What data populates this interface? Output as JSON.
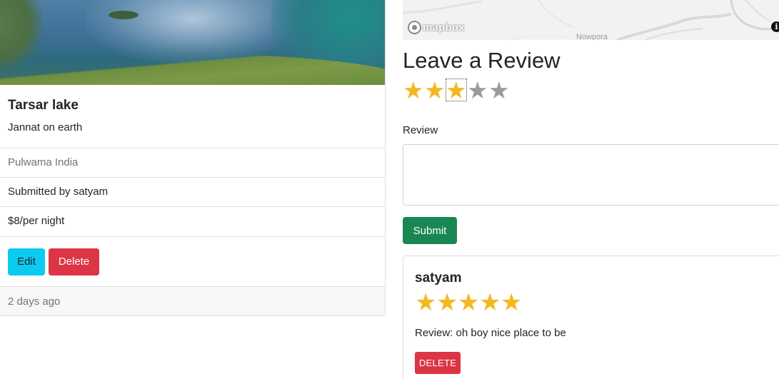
{
  "campground": {
    "title": "Tarsar lake",
    "description": "Jannat on earth",
    "location": "Pulwama India",
    "submitted_by": "Submitted by satyam",
    "price": "$8/per night",
    "edit_label": "Edit",
    "delete_label": "Delete",
    "posted": "2 days ago"
  },
  "map": {
    "logo_text": "mapbox",
    "place_label": "Nowpora",
    "info_icon": "i"
  },
  "review_form": {
    "heading": "Leave a Review",
    "rating_selected": 3,
    "rating_max": 5,
    "star_glyph": "★",
    "review_label": "Review",
    "review_value": "",
    "submit_label": "Submit"
  },
  "reviews": [
    {
      "author": "satyam",
      "rating": 5,
      "text": "Review: oh boy nice place to be",
      "delete_label": "DELETE"
    }
  ],
  "colors": {
    "star_on": "#f4b823",
    "star_off": "#9b9b9b",
    "info_button": "#0dcaf0",
    "danger": "#dc3545",
    "success": "#198754"
  }
}
